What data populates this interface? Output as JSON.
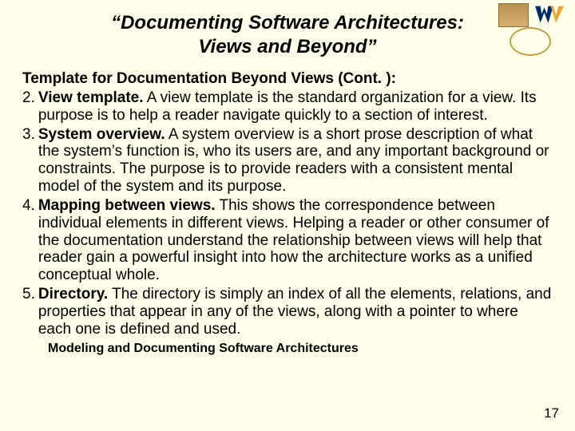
{
  "title": "“Documenting Software Architectures: Views and Beyond”",
  "subtitle": "Template for Documentation Beyond Views (Cont. ):",
  "items": [
    {
      "num": "2.",
      "term": "View template.",
      "text": " A view template is the standard organization for a view. Its purpose is to help a reader navigate quickly to a section of interest."
    },
    {
      "num": "3.",
      "term": "System overview.",
      "text": " A system overview is a short prose description of what the system’s function is, who its users are, and any important background or constraints. The purpose is to provide readers with a consistent mental model of the system and its purpose."
    },
    {
      "num": "4.",
      "term": "Mapping between views.",
      "text": " This shows the correspondence between individual elements in different views. Helping a reader or other consumer of the documentation understand the relationship between views will help that reader gain a powerful insight into how the architecture works as a unified conceptual whole."
    },
    {
      "num": "5.",
      "term": "Directory.",
      "text": " The directory is simply an index of all the elements, relations, and properties that appear in any of the views, along with a pointer to where each one is defined and used."
    }
  ],
  "footer": "Modeling and Documenting Software Architectures",
  "page_number": "17"
}
